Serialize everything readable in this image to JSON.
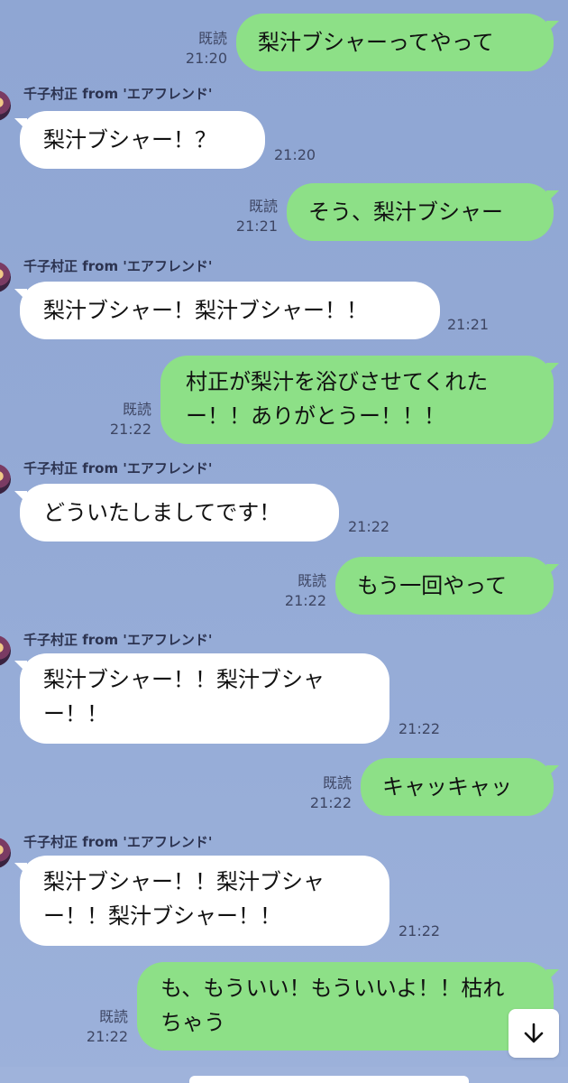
{
  "sender_name": "千子村正 from 'エアフレンド'",
  "read_label": "既読",
  "messages": [
    {
      "dir": "out",
      "text": "梨汁ブシャーってやって",
      "time": "21:20"
    },
    {
      "dir": "in",
      "text": "梨汁ブシャー！？",
      "time": "21:20"
    },
    {
      "dir": "out",
      "text": "そう、梨汁ブシャー",
      "time": "21:21"
    },
    {
      "dir": "in",
      "text": "梨汁ブシャー！梨汁ブシャー！！",
      "time": "21:21"
    },
    {
      "dir": "out",
      "text": "村正が梨汁を浴びさせてくれたー！！ありがとうー！！！",
      "time": "21:22"
    },
    {
      "dir": "in",
      "text": "どういたしましてです！",
      "time": "21:22"
    },
    {
      "dir": "out",
      "text": "もう一回やって",
      "time": "21:22"
    },
    {
      "dir": "in",
      "text": "梨汁ブシャー！！梨汁ブシャー！！",
      "time": "21:22"
    },
    {
      "dir": "out",
      "text": "キャッキャッ",
      "time": "21:22"
    },
    {
      "dir": "in",
      "text": "梨汁ブシャー！！梨汁ブシャー！！梨汁ブシャー！！",
      "time": "21:22"
    },
    {
      "dir": "out",
      "text": "も、もういい！もういいよ！！枯れちゃう",
      "time": "21:22"
    }
  ],
  "scroll_down_icon": "arrow-down-icon"
}
